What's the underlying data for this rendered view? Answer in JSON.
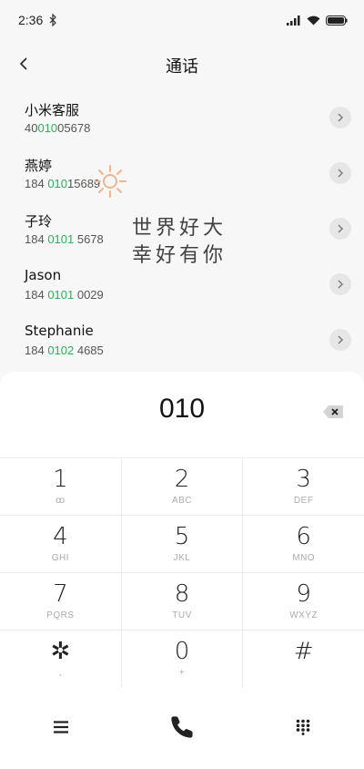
{
  "status": {
    "time": "2:36"
  },
  "header": {
    "title": "通话"
  },
  "contacts": [
    {
      "name": "小米客服",
      "pre": "40",
      "match": "010",
      "post": "05678"
    },
    {
      "name": "燕婷",
      "pre": "184 ",
      "match": "010",
      "post": "15689"
    },
    {
      "name": "子玲",
      "pre": "184 ",
      "match": "0101",
      "post": " 5678"
    },
    {
      "name": "Jason",
      "pre": "184 ",
      "match": "0101",
      "post": " 0029"
    },
    {
      "name": "Stephanie",
      "pre": "184 ",
      "match": "0102",
      "post": " 4685"
    }
  ],
  "watermark": {
    "line1": "世界好大",
    "line2": "幸好有你"
  },
  "dialer": {
    "digits": "010"
  },
  "keys": [
    [
      {
        "d": "1",
        "l": "ꝏ"
      },
      {
        "d": "2",
        "l": "ABC"
      },
      {
        "d": "3",
        "l": "DEF"
      }
    ],
    [
      {
        "d": "4",
        "l": "GHI"
      },
      {
        "d": "5",
        "l": "JKL"
      },
      {
        "d": "6",
        "l": "MNO"
      }
    ],
    [
      {
        "d": "7",
        "l": "PQRS"
      },
      {
        "d": "8",
        "l": "TUV"
      },
      {
        "d": "9",
        "l": "WXYZ"
      }
    ],
    [
      {
        "d": "✲",
        "l": ","
      },
      {
        "d": "0",
        "l": "+"
      },
      {
        "d": "#",
        "l": ""
      }
    ]
  ],
  "colors": {
    "highlight": "#2fae5d"
  },
  "icons": {
    "menu": "menu-icon",
    "call": "phone-icon",
    "dialpad": "dialpad-icon"
  }
}
